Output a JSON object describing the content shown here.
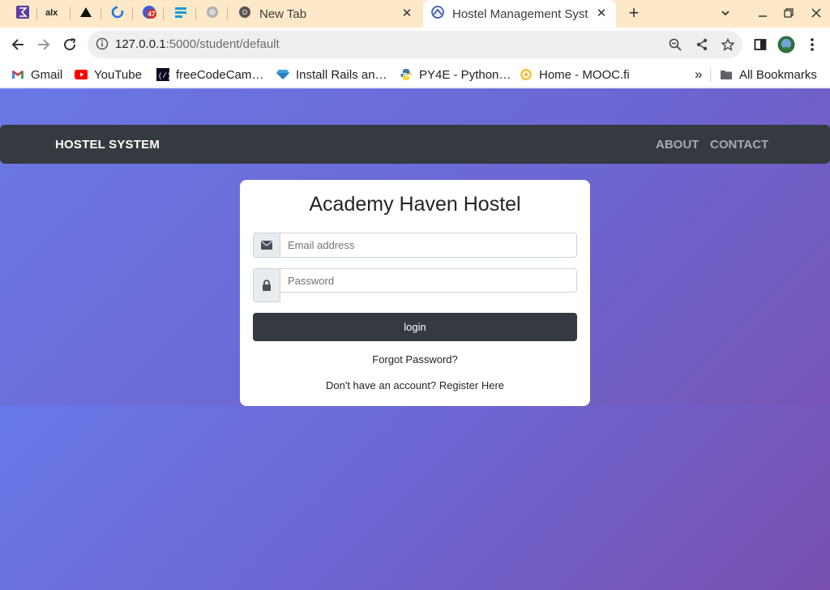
{
  "browser": {
    "tabs": [
      {
        "title": "New Tab",
        "active": false
      },
      {
        "title": "Hostel Management Syst",
        "active": true
      }
    ],
    "pinned_badge": "47",
    "address": {
      "host": "127.0.0.1",
      "path": ":5000/student/default"
    },
    "bookmarks": [
      {
        "label": "Gmail",
        "icon": "gmail-icon"
      },
      {
        "label": "YouTube",
        "icon": "youtube-icon"
      },
      {
        "label": "freeCodeCam…",
        "icon": "freecodecamp-icon"
      },
      {
        "label": "Install Rails an…",
        "icon": "ruby-gem-icon"
      },
      {
        "label": "PY4E - Python…",
        "icon": "python-icon"
      },
      {
        "label": "Home - MOOC.fi",
        "icon": "mooc-icon"
      }
    ],
    "overflow_label": "»",
    "all_bookmarks": "All Bookmarks"
  },
  "site": {
    "brand": "HOSTEL SYSTEM",
    "nav": {
      "about": "ABOUT",
      "contact": "CONTACT"
    }
  },
  "login": {
    "title": "Academy Haven Hostel",
    "email_placeholder": "Email address",
    "password_placeholder": "Password",
    "button": "login",
    "forgot": "Forgot Password?",
    "register_prompt": "Don't have an account?",
    "register_link": "Register Here"
  },
  "colors": {
    "navbar": "#343a40",
    "gradient_start": "#6a78e6",
    "gradient_end": "#7a4fac",
    "tabstrip": "#fde8c8"
  }
}
